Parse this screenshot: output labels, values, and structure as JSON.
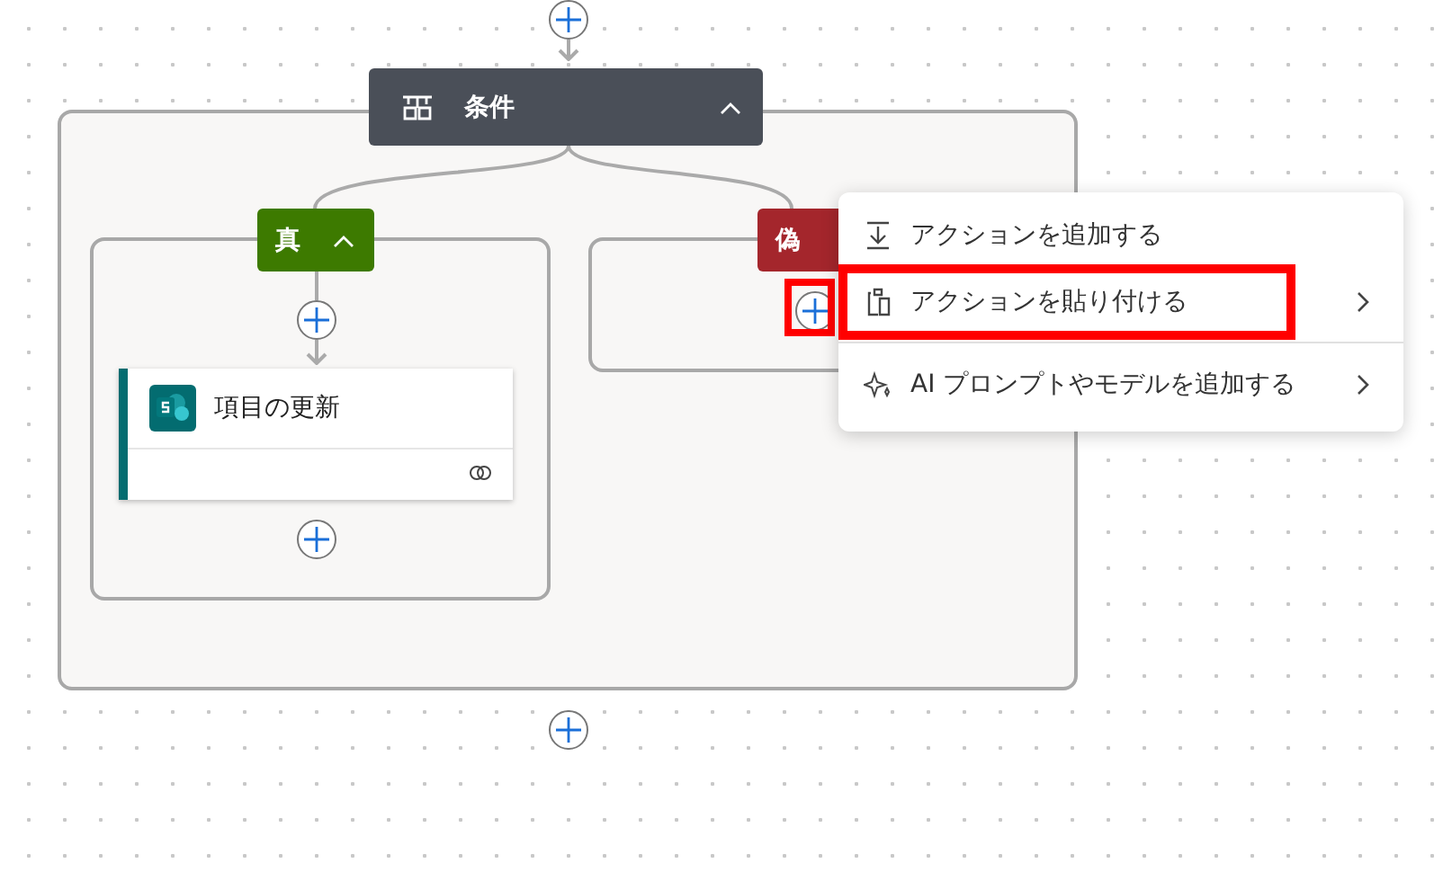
{
  "condition": {
    "title": "条件"
  },
  "branches": [
    {
      "label": "真",
      "color": "#3d7a00",
      "action": {
        "title": "項目の更新"
      },
      "add_highlighted": false
    },
    {
      "label": "偽",
      "color": "#a4262c",
      "add_highlighted": true
    }
  ],
  "menu": {
    "items": [
      {
        "label": "アクションを追加する",
        "kind": "add",
        "submenu": false,
        "highlighted": false
      },
      {
        "label": "アクションを貼り付ける",
        "kind": "paste",
        "submenu": true,
        "highlighted": true
      },
      {
        "label": "AI プロンプトやモデルを追加する",
        "kind": "ai",
        "submenu": true,
        "highlighted": false
      }
    ]
  }
}
